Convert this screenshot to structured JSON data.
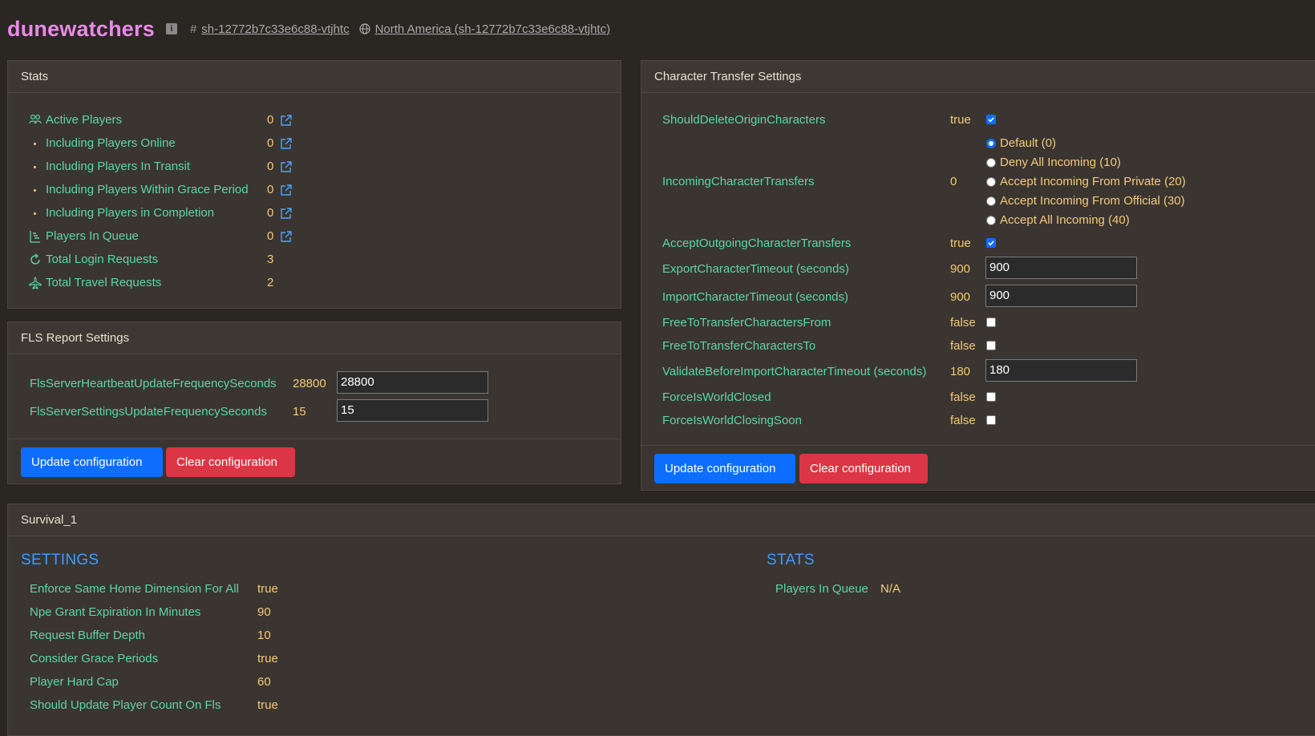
{
  "header": {
    "title": "dunewatchers",
    "info_icon_text": "i",
    "hash_symbol": "#",
    "server_id": "sh-12772b7c33e6c88-vtjhtc",
    "region_link": "North America (sh-12772b7c33e6c88-vtjhtc)"
  },
  "stats": {
    "title": "Stats",
    "rows": [
      {
        "label": "Active Players",
        "value": "0",
        "icon": "users-icon"
      },
      {
        "label": "Including Players Online",
        "value": "0",
        "icon": "bullet"
      },
      {
        "label": "Including Players In Transit",
        "value": "0",
        "icon": "bullet"
      },
      {
        "label": "Including Players Within Grace Period",
        "value": "0",
        "icon": "bullet"
      },
      {
        "label": "Including Players in Completion",
        "value": "0",
        "icon": "bullet"
      },
      {
        "label": "Players In Queue",
        "value": "0",
        "icon": "queue-icon"
      },
      {
        "label": "Total Login Requests",
        "value": "3",
        "icon": "refresh-icon"
      },
      {
        "label": "Total Travel Requests",
        "value": "2",
        "icon": "plane-icon"
      }
    ]
  },
  "fls": {
    "title": "FLS Report Settings",
    "rows": [
      {
        "label": "FlsServerHeartbeatUpdateFrequencySeconds",
        "value": "28800",
        "input": "28800"
      },
      {
        "label": "FlsServerSettingsUpdateFrequencySeconds",
        "value": "15",
        "input": "15"
      }
    ],
    "update_label": "Update configuration",
    "clear_label": "Clear configuration"
  },
  "transfer": {
    "title": "Character Transfer Settings",
    "should_delete": {
      "label": "ShouldDeleteOriginCharacters",
      "value": "true",
      "checked": true
    },
    "incoming": {
      "label": "IncomingCharacterTransfers",
      "value": "0",
      "options": [
        "Default (0)",
        "Deny All Incoming (10)",
        "Accept Incoming From Private (20)",
        "Accept Incoming From Official (30)",
        "Accept All Incoming (40)"
      ],
      "selected_index": 0
    },
    "accept_outgoing": {
      "label": "AcceptOutgoingCharacterTransfers",
      "value": "true",
      "checked": true
    },
    "export_timeout": {
      "label": "ExportCharacterTimeout (seconds)",
      "value": "900",
      "input": "900"
    },
    "import_timeout": {
      "label": "ImportCharacterTimeout (seconds)",
      "value": "900",
      "input": "900"
    },
    "free_from": {
      "label": "FreeToTransferCharactersFrom",
      "value": "false",
      "checked": false
    },
    "free_to": {
      "label": "FreeToTransferCharactersTo",
      "value": "false",
      "checked": false
    },
    "validate_timeout": {
      "label": "ValidateBeforeImportCharacterTimeout (seconds)",
      "value": "180",
      "input": "180"
    },
    "force_closed": {
      "label": "ForceIsWorldClosed",
      "value": "false",
      "checked": false
    },
    "force_closing_soon": {
      "label": "ForceIsWorldClosingSoon",
      "value": "false",
      "checked": false
    },
    "update_label": "Update configuration",
    "clear_label": "Clear configuration"
  },
  "survival": {
    "title": "Survival_1",
    "settings_title": "SETTINGS",
    "settings": [
      {
        "label": "Enforce Same Home Dimension For All",
        "value": "true"
      },
      {
        "label": "Npe Grant Expiration In Minutes",
        "value": "90"
      },
      {
        "label": "Request Buffer Depth",
        "value": "10"
      },
      {
        "label": "Consider Grace Periods",
        "value": "true"
      },
      {
        "label": "Player Hard Cap",
        "value": "60"
      },
      {
        "label": "Should Update Player Count On Fls",
        "value": "true"
      }
    ],
    "stats_title": "STATS",
    "stats": [
      {
        "label": "Players In Queue",
        "value": "N/A"
      }
    ]
  },
  "colors": {
    "background": "#2a2622",
    "panel": "#3a3530",
    "label_green": "#5bd6a8",
    "value_yellow": "#f5c97a",
    "title_pink": "#e88ae8",
    "section_blue": "#3d9bff",
    "button_blue": "#0d6efd",
    "button_red": "#dc3545"
  }
}
